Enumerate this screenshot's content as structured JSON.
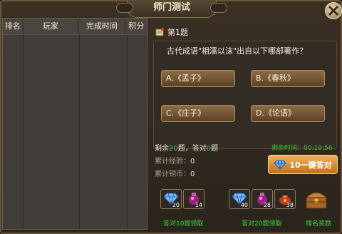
{
  "window": {
    "title": "师门测试"
  },
  "ranking_table": {
    "headers": [
      "排名",
      "玩家",
      "完成时间",
      "积分"
    ]
  },
  "question": {
    "number_label": "第1题",
    "text": "古代成语\"相濡以沫\"出自以下哪部著作？",
    "options": [
      "A.《孟子》",
      "B.《春秋》",
      "C.《庄子》",
      "D.《论语》"
    ]
  },
  "progress": {
    "remaining_prefix": "剩余",
    "remaining_count": "20",
    "remaining_suffix": "题，答对",
    "correct_count": "0",
    "correct_suffix": "题",
    "time_label": "剩余时间：",
    "time_value": "00:19:56",
    "exp_label": "累计经验：",
    "exp_value": "0",
    "coin_label": "累计铜币：",
    "coin_value": "0"
  },
  "one_click_button": {
    "label": "10一键答对"
  },
  "rewards": {
    "group1": {
      "label": "答对10题领取",
      "items": [
        {
          "icon": "diamond-icon",
          "count": "20"
        },
        {
          "icon": "potion-icon",
          "count": "14"
        }
      ]
    },
    "group2": {
      "label": "答对20题领取",
      "items": [
        {
          "icon": "diamond-icon",
          "count": "40"
        },
        {
          "icon": "potion-icon",
          "count": "28"
        },
        {
          "icon": "pouch-icon",
          "count": "38"
        }
      ]
    },
    "rank_reward": {
      "label": "排名奖励",
      "icon": "treasure-chest-icon"
    }
  },
  "colors": {
    "accent_green": "#38c838",
    "button_orange": "#c47018",
    "panel_brown": "#332c24"
  }
}
